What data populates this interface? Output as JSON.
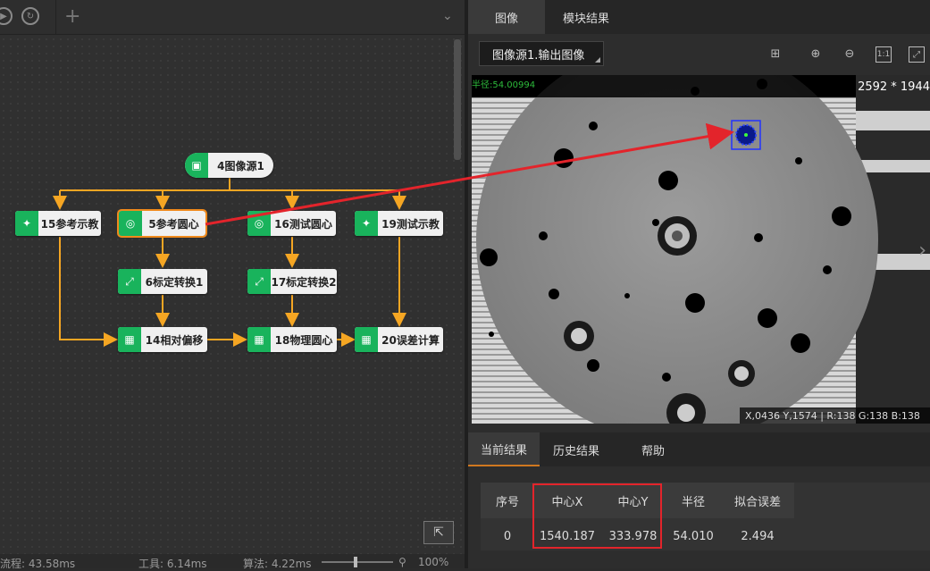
{
  "flow": {
    "toolbar": {
      "add_symbol": "+",
      "collapse_symbol": "⌄"
    },
    "nodes": [
      {
        "id": "n4",
        "label": "4图像源1"
      },
      {
        "id": "n15",
        "label": "15参考示教"
      },
      {
        "id": "n5",
        "label": "5参考圆心"
      },
      {
        "id": "n16",
        "label": "16测试圆心"
      },
      {
        "id": "n19",
        "label": "19测试示教"
      },
      {
        "id": "n6",
        "label": "6标定转换1"
      },
      {
        "id": "n17",
        "label": "17标定转换2"
      },
      {
        "id": "n14",
        "label": "14相对偏移"
      },
      {
        "id": "n18",
        "label": "18物理圆心"
      },
      {
        "id": "n20",
        "label": "20误差计算"
      }
    ],
    "selected": "n5",
    "edge_color": "#f5a623",
    "node_icon_color": "#19b35c",
    "selection_color": "#f08a1c"
  },
  "status": {
    "process": "流程: 43.58ms",
    "tool": "工具: 6.14ms",
    "algo": "算法: 4.22ms",
    "zoom": "100%"
  },
  "image_panel": {
    "tabs": [
      "图像",
      "模块结果"
    ],
    "active_tab": "图像",
    "source_select": "图像源1.输出图像",
    "size_text": "2592 * 1944",
    "radius_text": "半径:54.00994",
    "coords_text": "X,0436  Y,1574  |  R:138  G:138  B:138"
  },
  "results": {
    "tabs": [
      "当前结果",
      "历史结果",
      "帮助"
    ],
    "active_tab": "当前结果",
    "columns": [
      "序号",
      "中心X",
      "中心Y",
      "半径",
      "拟合误差"
    ],
    "rows": [
      [
        "0",
        "1540.187",
        "333.978",
        "54.010",
        "2.494"
      ]
    ]
  },
  "annotation_color": "#e3242b"
}
